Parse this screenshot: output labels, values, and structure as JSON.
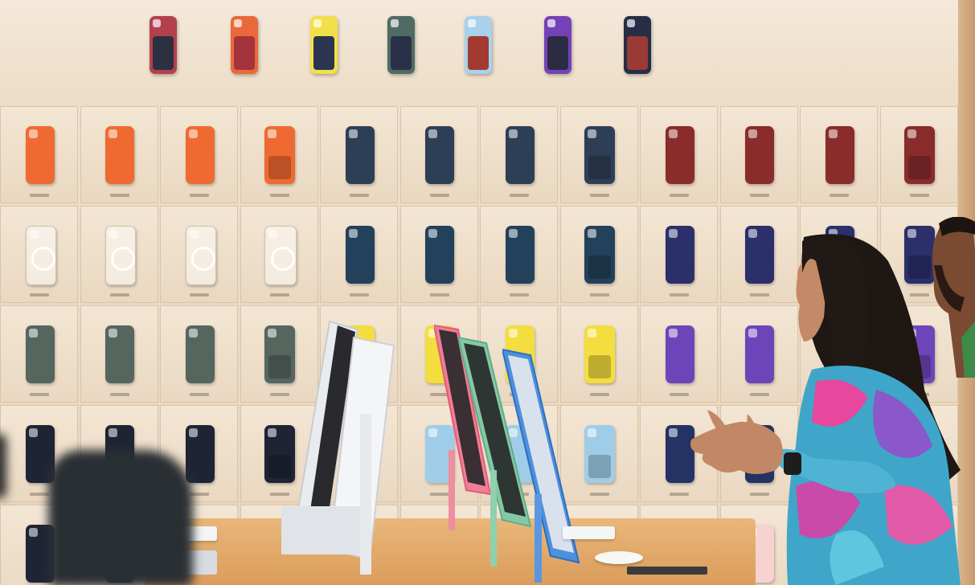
{
  "scene": {
    "description_type": "photo",
    "wall_color": "#efe0cc",
    "table_color": "#dda465"
  },
  "top_row_cases": [
    {
      "case_color": "#b2414e",
      "wallet_color": "#2c3141"
    },
    {
      "case_color": "#e9693a",
      "wallet_color": "#a5333b"
    },
    {
      "case_color": "#f2e04a",
      "wallet_color": "#2b3550"
    },
    {
      "case_color": "#4f6b63",
      "wallet_color": "#2b3049"
    },
    {
      "case_color": "#a9d1ea",
      "wallet_color": "#a23a32"
    },
    {
      "case_color": "#7442b6",
      "wallet_color": "#2b2c44"
    },
    {
      "case_color": "#262d45",
      "wallet_color": "#9a3a34"
    }
  ],
  "grid_rows": [
    [
      "#ef6a30",
      "#ef6a30",
      "#ef6a30",
      "#ef6a30",
      "#2d3f56",
      "#2d3f56",
      "#2d3f56",
      "#2d3f56",
      "#8a2c2c",
      "#8a2c2c",
      "#8a2c2c",
      "#8a2c2c"
    ],
    [
      "clear",
      "clear",
      "clear",
      "clear-white",
      "#23415a",
      "#23415a",
      "#23415a",
      "#23415a",
      "#2b2f6a",
      "#2b2f6a",
      "#2b2f6a",
      "#2b2f6a"
    ],
    [
      "#55665f",
      "#55665f",
      "#55665f",
      "#55665f",
      "#f4dd3e",
      "#f4dd3e",
      "#f4dd3e",
      "#f4dd3e",
      "#6d45b8",
      "#6d45b8",
      "#6d45b8",
      "#6d45b8"
    ],
    [
      "#1f2434",
      "#1f2434",
      "#1f2434",
      "#1f2434",
      "#9fcde8",
      "#9fcde8",
      "#9fcde8",
      "#9fcde8",
      "#243264",
      "#243264",
      "#243264",
      "#243264"
    ],
    [
      "#1f2434",
      "#1f2434",
      "#1f2434",
      "#1f2434",
      "#f1d9d6",
      "#f1d9d6",
      "#f1d9d6",
      "#f1d9d6",
      "#f6d2d0",
      "#f6d2d0",
      "#f6d2d0",
      "#f6d2d0"
    ]
  ],
  "wallet_columns": [
    3,
    7,
    11
  ]
}
